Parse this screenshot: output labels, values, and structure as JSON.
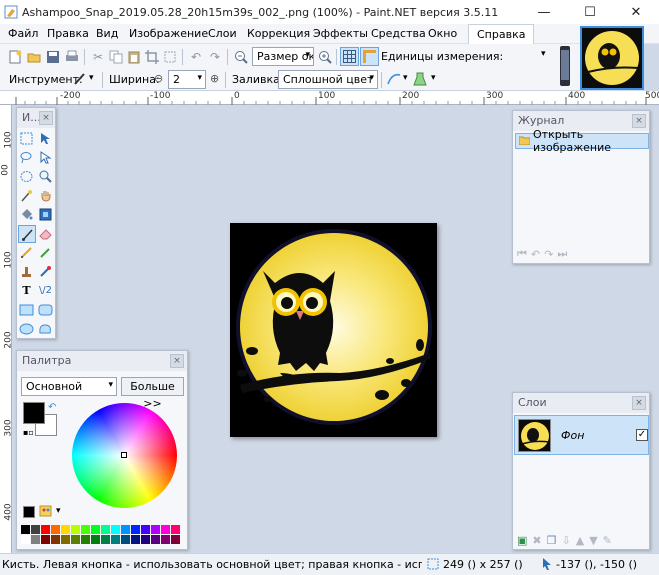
{
  "window": {
    "title": "Ashampoo_Snap_2019.05.28_20h15m39s_002_.png (100%) - Paint.NET версия 3.5.11",
    "minimize": "—",
    "maximize": "☐",
    "close": "✕"
  },
  "menu": [
    "Файл",
    "Правка",
    "Вид",
    "Изображение",
    "Слои",
    "Коррекция",
    "Эффекты",
    "Средства",
    "Окно",
    "Справка"
  ],
  "toolbar": {
    "zoom_label": "Размер ок",
    "units_label": "Единицы измерения:"
  },
  "toolbar2": {
    "tool_label": "Инструмент:",
    "width_label": "Ширина:",
    "width_value": "2",
    "fill_label": "Заливка:",
    "fill_value": "Сплошной цвет"
  },
  "ruler": {
    "h": [
      "-200",
      "-100",
      "0",
      "100",
      "200",
      "300",
      "400",
      "500"
    ],
    "v": [
      "100",
      "00",
      "100",
      "200",
      "300",
      "400"
    ]
  },
  "tools_panel": {
    "title": "И..."
  },
  "history": {
    "title": "Журнал",
    "item": "Открыть изображение"
  },
  "palette": {
    "title": "Палитра",
    "mode": "Основной",
    "more": "Больше >>"
  },
  "layers": {
    "title": "Слои",
    "layer_name": "Фон"
  },
  "status": {
    "hint": "Кисть. Левая кнопка - использовать основной цвет; правая кнопка - использовать дополнит",
    "size": "249 () x 257 ()",
    "coords": "-137 (), -150 ()"
  },
  "colors": {
    "accent": "#3d8edb",
    "moon": "#f7df55",
    "sel": "#cde4f8"
  }
}
